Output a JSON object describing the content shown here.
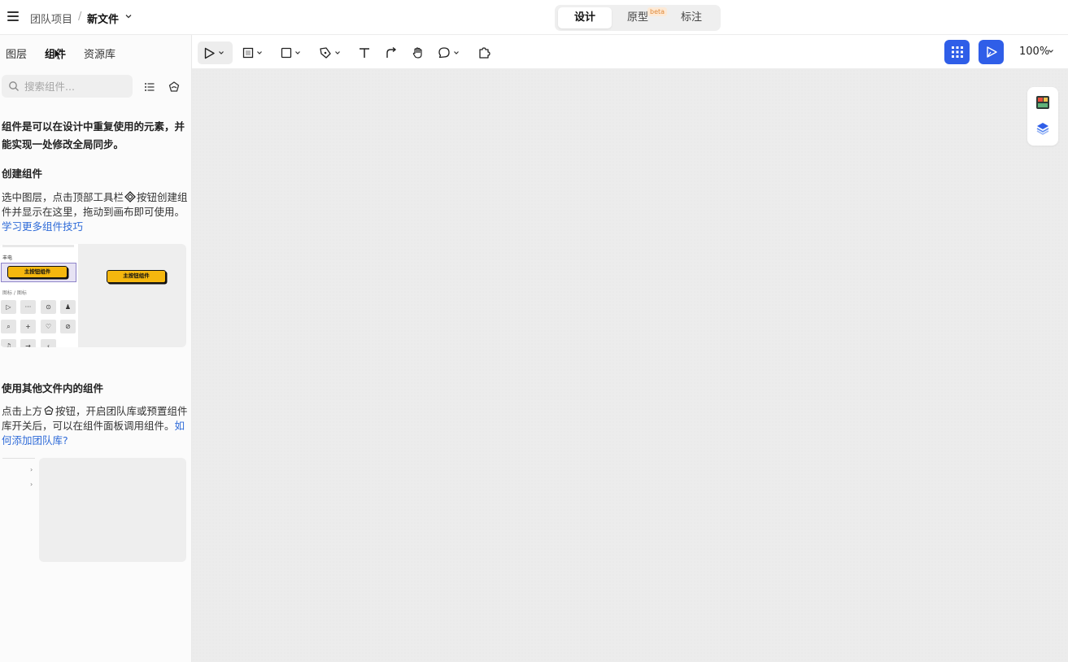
{
  "topbar": {
    "team": "团队项目",
    "separator": "/",
    "file_name": "新文件",
    "modes": [
      "设计",
      "原型",
      "标注"
    ],
    "active_mode": "设计",
    "beta_badge": "beta"
  },
  "left_panel": {
    "tabs": [
      "图层",
      "组件",
      "资源库"
    ],
    "active_tab": "组件",
    "search_placeholder": "搜索组件...",
    "intro": "组件是可以在设计中重复使用的元素，并能实现一处修改全局同步。",
    "create_heading": "创建组件",
    "create_text_a": "选中图层，点击顶部工具栏",
    "create_text_b": "按钮创建组件并显示在这里，拖动到画布即可使用。",
    "create_link": "学习更多组件技巧",
    "preview1": {
      "left_label": "丰电",
      "left_section": "图标 / 图标",
      "selected_button": "主按钮组件",
      "canvas_button": "主按钮组件",
      "icon_glyphs": [
        "▷",
        "···",
        "⊙",
        "♟",
        "⌕",
        "+",
        "♡",
        "⊘",
        "♫",
        "→",
        "‹"
      ]
    },
    "other_heading": "使用其他文件内的组件",
    "other_text_a": "点击上方",
    "other_text_b": "按钮，开启团队库或预置组件库开关后，可以在组件面板调用组件。",
    "other_link": "如何添加团队库?"
  },
  "toolbar": {
    "tools": [
      "move-tool",
      "frame-tool",
      "rectangle-tool",
      "pen-tool",
      "text-tool",
      "connector-tool",
      "hand-tool",
      "comment-tool",
      "plugin-tool"
    ],
    "zoom": "100%"
  },
  "colors": {
    "accent": "#2f5ee8",
    "link": "#2f6bd8",
    "component_yellow": "#f5b70e",
    "canvas": "#ececec"
  }
}
